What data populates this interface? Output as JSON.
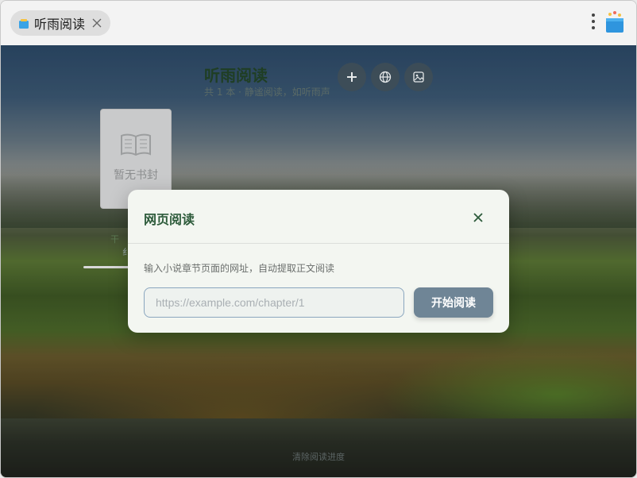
{
  "tab": {
    "title": "听雨阅读",
    "icon": "book-icon"
  },
  "library": {
    "title": "听雨阅读",
    "subtitle": "共 1 本 · 静谧阅读，如听雨声",
    "toolbar": [
      "plus-icon",
      "globe-icon",
      "image-icon"
    ],
    "book": {
      "cover_text": "暂无书封",
      "name_fragment": "干",
      "meta_fragment": "纟"
    },
    "clear_progress": "清除阅读进度"
  },
  "modal": {
    "title": "网页阅读",
    "description": "输入小说章节页面的网址，自动提取正文阅读",
    "input": {
      "value": "",
      "placeholder": "https://example.com/chapter/1"
    },
    "submit_label": "开始阅读"
  },
  "colors": {
    "accent": "#2c5a3a",
    "button": "#6f8596",
    "input_border": "#8aa6bf"
  }
}
